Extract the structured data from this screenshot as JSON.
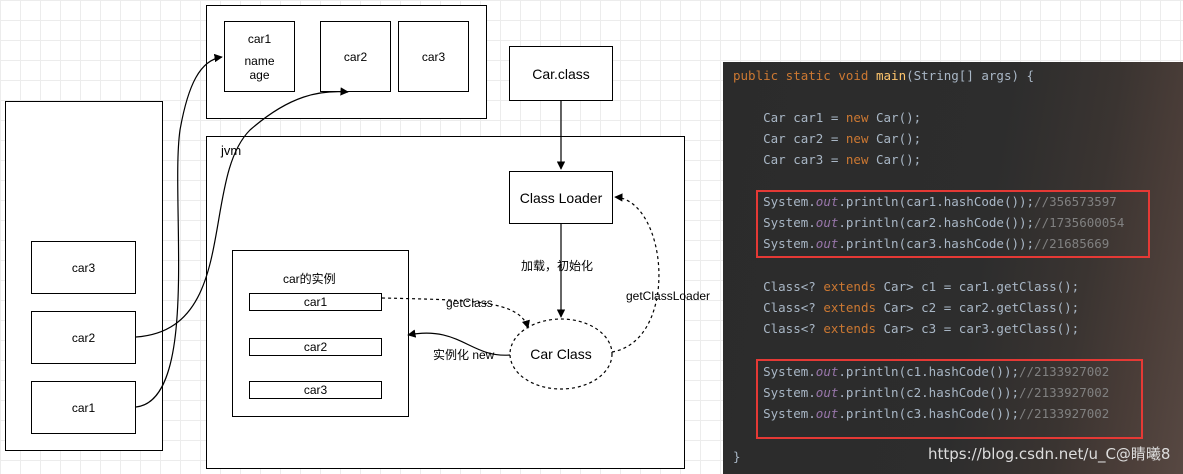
{
  "diagram": {
    "heap_instances": [
      "car1",
      "car2",
      "car3"
    ],
    "car1_fields": [
      "car1",
      "name",
      "age"
    ],
    "car2": "car2",
    "car3": "car3",
    "car_class_file": "Car.class",
    "jvm_label": "jvm",
    "class_loader": "Class Loader",
    "load_init_label": "加载，初始化",
    "car_class": "Car Class",
    "get_class_loader_label": "getClassLoader",
    "instances_title": "car的实例",
    "instances": [
      "car1",
      "car2",
      "car3"
    ],
    "get_class_label": "getClass",
    "instantiate_label": "实例化 new",
    "stack_refs": [
      "car3",
      "car2",
      "car1"
    ]
  },
  "code": {
    "lines": [
      [
        {
          "t": "public static void ",
          "c": "kw"
        },
        {
          "t": "main",
          "c": "fn"
        },
        {
          "t": "(String[] args) {",
          "c": ""
        }
      ],
      [
        {
          "t": "    Car car1 = ",
          "c": ""
        },
        {
          "t": "new ",
          "c": "kw"
        },
        {
          "t": "Car();",
          "c": ""
        }
      ],
      [
        {
          "t": "    Car car2 = ",
          "c": ""
        },
        {
          "t": "new ",
          "c": "kw"
        },
        {
          "t": "Car();",
          "c": ""
        }
      ],
      [
        {
          "t": "    Car car3 = ",
          "c": ""
        },
        {
          "t": "new ",
          "c": "kw"
        },
        {
          "t": "Car();",
          "c": ""
        }
      ],
      [
        {
          "t": "    System.",
          "c": ""
        },
        {
          "t": "out",
          "c": "it"
        },
        {
          "t": ".println(car1.hashCode());",
          "c": ""
        },
        {
          "t": "//356573597",
          "c": "cm"
        }
      ],
      [
        {
          "t": "    System.",
          "c": ""
        },
        {
          "t": "out",
          "c": "it"
        },
        {
          "t": ".println(car2.hashCode());",
          "c": ""
        },
        {
          "t": "//1735600054",
          "c": "cm"
        }
      ],
      [
        {
          "t": "    System.",
          "c": ""
        },
        {
          "t": "out",
          "c": "it"
        },
        {
          "t": ".println(car3.hashCode());",
          "c": ""
        },
        {
          "t": "//21685669",
          "c": "cm"
        }
      ],
      [
        {
          "t": "    Class<? ",
          "c": ""
        },
        {
          "t": "extends ",
          "c": "kw"
        },
        {
          "t": "Car> c1 = car1.getClass();",
          "c": ""
        }
      ],
      [
        {
          "t": "    Class<? ",
          "c": ""
        },
        {
          "t": "extends ",
          "c": "kw"
        },
        {
          "t": "Car> c2 = car2.getClass();",
          "c": ""
        }
      ],
      [
        {
          "t": "    Class<? ",
          "c": ""
        },
        {
          "t": "extends ",
          "c": "kw"
        },
        {
          "t": "Car> c3 = car3.getClass();",
          "c": ""
        }
      ],
      [
        {
          "t": "    System.",
          "c": ""
        },
        {
          "t": "out",
          "c": "it"
        },
        {
          "t": ".println(c1.hashCode());",
          "c": ""
        },
        {
          "t": "//2133927002",
          "c": "cm"
        }
      ],
      [
        {
          "t": "    System.",
          "c": ""
        },
        {
          "t": "out",
          "c": "it"
        },
        {
          "t": ".println(c2.hashCode());",
          "c": ""
        },
        {
          "t": "//2133927002",
          "c": "cm"
        }
      ],
      [
        {
          "t": "    System.",
          "c": ""
        },
        {
          "t": "out",
          "c": "it"
        },
        {
          "t": ".println(c3.hashCode());",
          "c": ""
        },
        {
          "t": "//2133927002",
          "c": "cm"
        }
      ],
      [
        {
          "t": "}",
          "c": ""
        }
      ]
    ],
    "watermark": "https://blog.csdn.net/u_C@睛曦8",
    "highlight_color": "#e53935"
  }
}
